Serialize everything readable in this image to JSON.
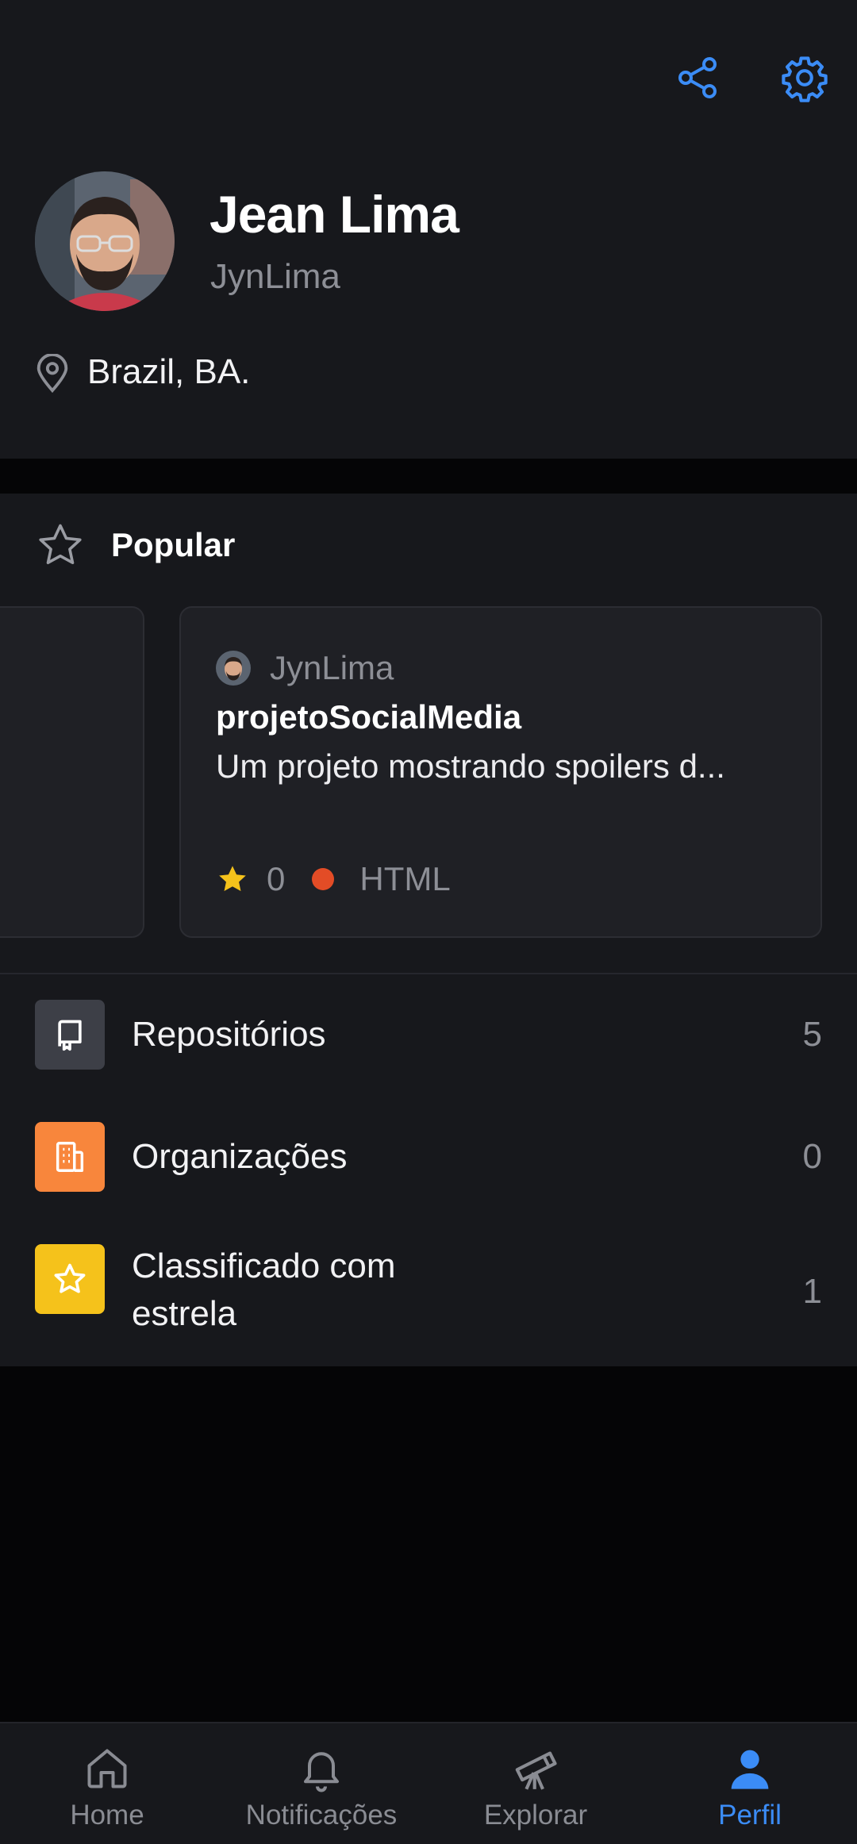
{
  "profile": {
    "name": "Jean Lima",
    "username": "JynLima",
    "location": "Brazil, BA."
  },
  "popular": {
    "title": "Popular",
    "card": {
      "owner": "JynLima",
      "repo_name": "projetoSocialMedia",
      "description": "Um projeto mostrando spoilers d...",
      "stars": "0",
      "language": "HTML",
      "language_color": "#e34c26"
    }
  },
  "menu": [
    {
      "label": "Repositórios",
      "count": "5",
      "icon": "repo-icon",
      "color": "#3d3f47"
    },
    {
      "label": "Organizações",
      "count": "0",
      "icon": "organization-icon",
      "color": "#f8863c"
    },
    {
      "label": "Classificado com estrela",
      "count": "1",
      "icon": "star-icon",
      "color": "#f5c21b"
    }
  ],
  "nav": {
    "items": [
      {
        "label": "Home",
        "icon": "home-icon",
        "active": false
      },
      {
        "label": "Notificações",
        "icon": "bell-icon",
        "active": false
      },
      {
        "label": "Explorar",
        "icon": "telescope-icon",
        "active": false
      },
      {
        "label": "Perfil",
        "icon": "person-icon",
        "active": true
      }
    ]
  },
  "colors": {
    "accent": "#3b8cf6",
    "background": "#17181c",
    "star": "#f5c21b"
  }
}
